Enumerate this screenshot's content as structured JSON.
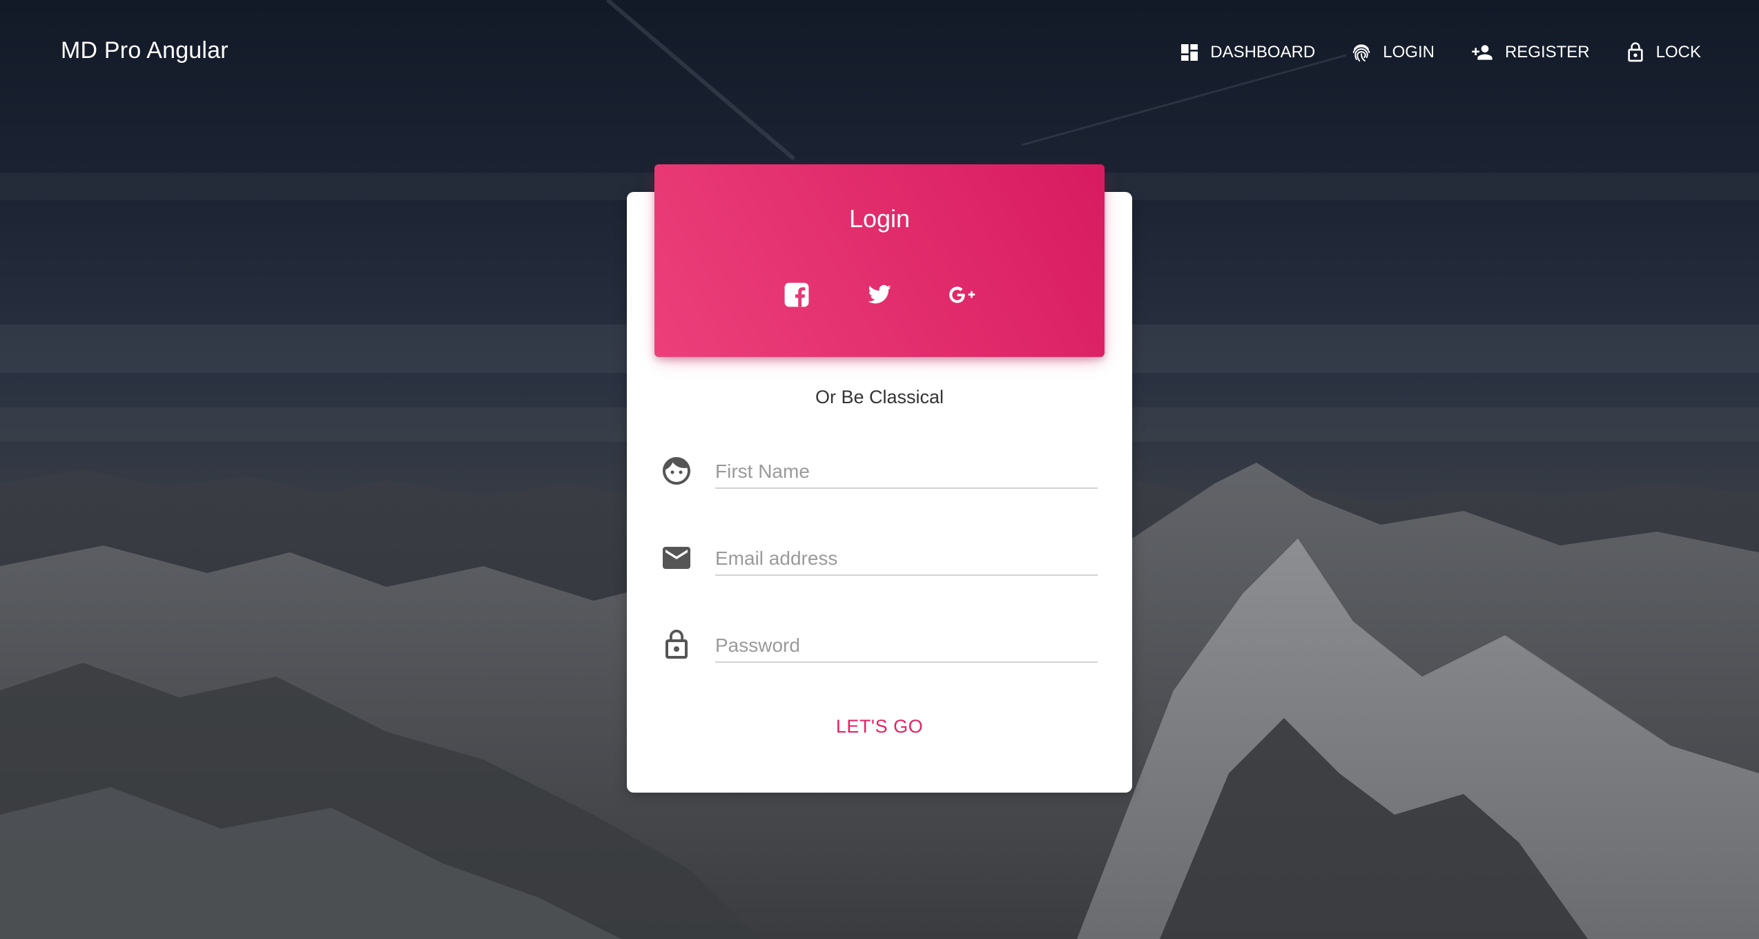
{
  "brand": "MD Pro Angular",
  "nav": {
    "items": [
      {
        "icon": "dashboard-icon",
        "label": "DASHBOARD"
      },
      {
        "icon": "fingerprint-icon",
        "label": "LOGIN"
      },
      {
        "icon": "person-add-icon",
        "label": "REGISTER"
      },
      {
        "icon": "lock-open-icon",
        "label": "LOCK"
      }
    ]
  },
  "card": {
    "title": "Login",
    "socials": [
      "facebook-icon",
      "twitter-icon",
      "google-plus-icon"
    ],
    "divider_text": "Or Be Classical",
    "fields": [
      {
        "icon": "face-icon",
        "placeholder": "First Name",
        "value": ""
      },
      {
        "icon": "email-icon",
        "placeholder": "Email address",
        "value": ""
      },
      {
        "icon": "lock-outline-icon",
        "placeholder": "Password",
        "value": ""
      }
    ],
    "submit_label": "LET'S GO"
  },
  "colors": {
    "accent": "#e91e63",
    "header_gradient_start": "#ec407a",
    "header_gradient_end": "#d81b60"
  }
}
